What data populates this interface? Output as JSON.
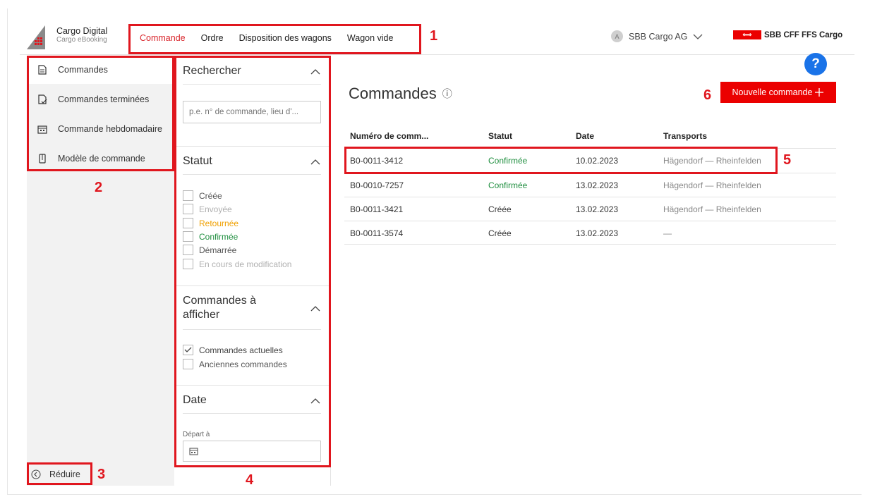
{
  "brand": {
    "title": "Cargo Digital",
    "subtitle": "Cargo eBooking"
  },
  "nav": {
    "items": [
      "Commande",
      "Ordre",
      "Disposition des wagons",
      "Wagon vide"
    ],
    "active_index": 0
  },
  "user": {
    "avatar_letter": "A",
    "name": "SBB Cargo AG"
  },
  "sbb_logo": {
    "text": "SBB CFF FFS Cargo",
    "flag_glyph": "⟺"
  },
  "sidebar": {
    "items": [
      {
        "label": "Commandes",
        "icon": "document-icon"
      },
      {
        "label": "Commandes terminées",
        "icon": "document-check-icon"
      },
      {
        "label": "Commande hebdomadaire",
        "icon": "calendar-icon"
      },
      {
        "label": "Modèle de commande",
        "icon": "template-icon"
      }
    ],
    "reduce_label": "Réduire"
  },
  "filter": {
    "search": {
      "title": "Rechercher",
      "placeholder": "p.e. n° de commande, lieu d'..."
    },
    "status": {
      "title": "Statut",
      "options": [
        {
          "label": "Créée",
          "checked": false
        },
        {
          "label": "Envoyée",
          "checked": false
        },
        {
          "label": "Retournée",
          "checked": false
        },
        {
          "label": "Confirmée",
          "checked": false
        },
        {
          "label": "Démarrée",
          "checked": false
        },
        {
          "label": "En cours de modification",
          "checked": false
        }
      ]
    },
    "show": {
      "title": "Commandes à afficher",
      "options": [
        {
          "label": "Commandes actuelles",
          "checked": true
        },
        {
          "label": "Anciennes commandes",
          "checked": false
        }
      ]
    },
    "date": {
      "title": "Date",
      "departure_label": "Départ à"
    }
  },
  "main": {
    "title": "Commandes",
    "new_button": "Nouvelle commande",
    "help": "?",
    "columns": [
      "Numéro de comm...",
      "Statut",
      "Date",
      "Transports"
    ],
    "rows": [
      {
        "number": "B0-0011-3412",
        "status": "Confirmée",
        "date": "10.02.2023",
        "transport": "Hägendorf — Rheinfelden"
      },
      {
        "number": "B0-0010-7257",
        "status": "Confirmée",
        "date": "13.02.2023",
        "transport": "Hägendorf — Rheinfelden"
      },
      {
        "number": "B0-0011-3421",
        "status": "Créée",
        "date": "13.02.2023",
        "transport": "Hägendorf — Rheinfelden"
      },
      {
        "number": "B0-0011-3574",
        "status": "Créée",
        "date": "13.02.2023",
        "transport": "—"
      }
    ]
  },
  "annotations": [
    "1",
    "2",
    "3",
    "4",
    "5",
    "6"
  ],
  "colors": {
    "accent_red": "#eb0000",
    "annotation_red": "#e0161e",
    "confirmed_green": "#1e8e3e",
    "returned_orange": "#f0a000",
    "help_blue": "#1a73e8"
  }
}
